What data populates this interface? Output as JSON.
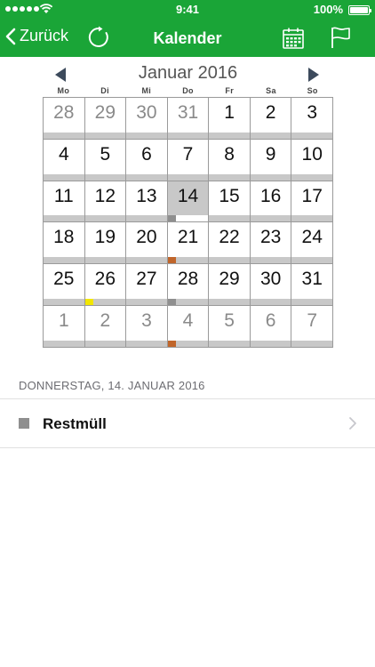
{
  "status_bar": {
    "time": "9:41",
    "battery_percent": "100%",
    "signal_bars": 5
  },
  "nav": {
    "back_label": "Zurück",
    "title": "Kalender",
    "background_color": "#1aa537",
    "icons": [
      "chevron-left-icon",
      "refresh-icon",
      "calendar-icon",
      "flag-icon"
    ]
  },
  "calendar": {
    "month_title": "Januar 2016",
    "weekdays": [
      "Mo",
      "Di",
      "Mi",
      "Do",
      "Fr",
      "Sa",
      "So"
    ],
    "selected_day": "14",
    "weeks": [
      [
        {
          "d": "28",
          "o": true
        },
        {
          "d": "29",
          "o": true
        },
        {
          "d": "30",
          "o": true
        },
        {
          "d": "31",
          "o": true
        },
        {
          "d": "1"
        },
        {
          "d": "2"
        },
        {
          "d": "3"
        }
      ],
      [
        {
          "d": "4"
        },
        {
          "d": "5"
        },
        {
          "d": "6"
        },
        {
          "d": "7"
        },
        {
          "d": "8"
        },
        {
          "d": "9"
        },
        {
          "d": "10"
        }
      ],
      [
        {
          "d": "11"
        },
        {
          "d": "12"
        },
        {
          "d": "13"
        },
        {
          "d": "14",
          "sel": true,
          "m": "#8f8f8f"
        },
        {
          "d": "15"
        },
        {
          "d": "16"
        },
        {
          "d": "17"
        }
      ],
      [
        {
          "d": "18"
        },
        {
          "d": "19"
        },
        {
          "d": "20"
        },
        {
          "d": "21",
          "m": "#c0652a"
        },
        {
          "d": "22"
        },
        {
          "d": "23"
        },
        {
          "d": "24"
        }
      ],
      [
        {
          "d": "25"
        },
        {
          "d": "26",
          "m": "#f2e600"
        },
        {
          "d": "27"
        },
        {
          "d": "28",
          "m": "#8f8f8f"
        },
        {
          "d": "29"
        },
        {
          "d": "30"
        },
        {
          "d": "31"
        }
      ],
      [
        {
          "d": "1",
          "o": true
        },
        {
          "d": "2",
          "o": true
        },
        {
          "d": "3",
          "o": true
        },
        {
          "d": "4",
          "o": true,
          "m": "#c0652a"
        },
        {
          "d": "5",
          "o": true
        },
        {
          "d": "6",
          "o": true
        },
        {
          "d": "7",
          "o": true
        }
      ]
    ]
  },
  "events": {
    "date_heading": "DONNERSTAG, 14. JANUAR 2016",
    "items": [
      {
        "label": "Restmüll",
        "color": "#8f8f8f"
      }
    ]
  }
}
